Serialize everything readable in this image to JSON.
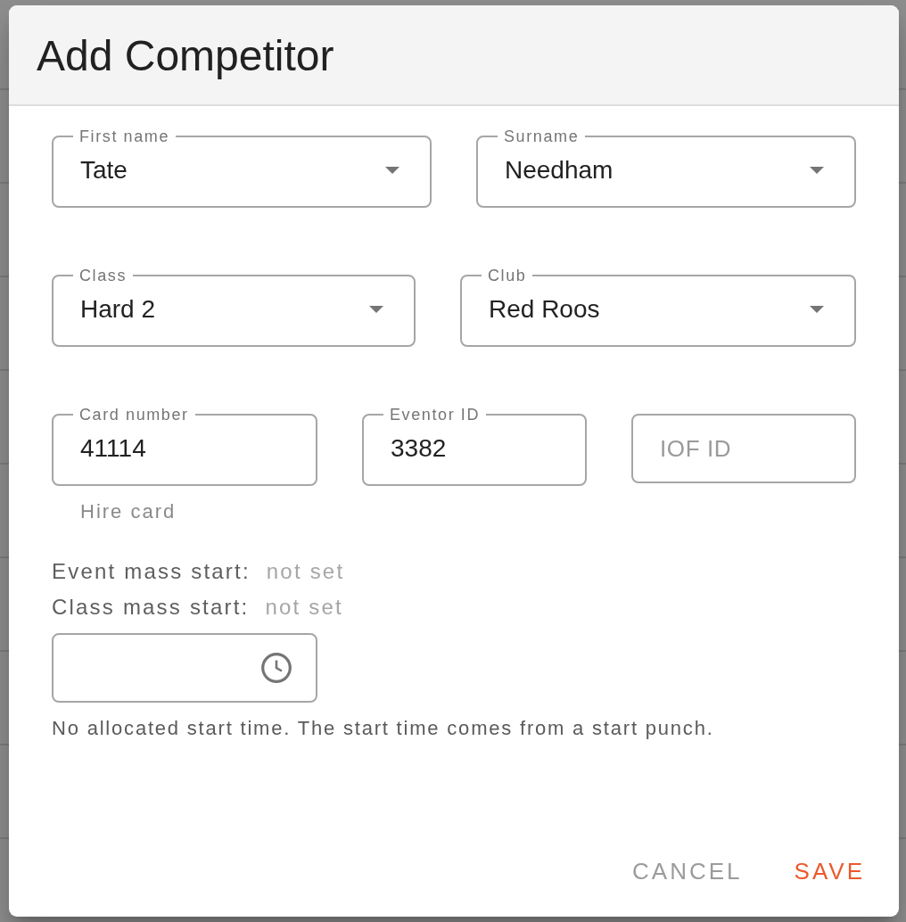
{
  "dialog": {
    "title": "Add Competitor"
  },
  "field_rows": [
    [
      {
        "kind": "select",
        "label": "First name",
        "value": "Tate"
      },
      {
        "kind": "select",
        "label": "Surname",
        "value": "Needham"
      }
    ],
    [
      {
        "kind": "select",
        "label": "Class",
        "value": "Hard 2"
      },
      {
        "kind": "select",
        "label": "Club",
        "value": "Red Roos"
      }
    ],
    [
      {
        "kind": "text",
        "label": "Card number",
        "value": "41114",
        "helper": "Hire card"
      },
      {
        "kind": "text",
        "label": "Eventor ID",
        "value": "3382"
      },
      {
        "kind": "text",
        "placeholder": "IOF ID"
      }
    ]
  ],
  "mass_starts": [
    {
      "label": "Event mass start:",
      "value": "not set"
    },
    {
      "label": "Class mass start:",
      "value": "not set"
    }
  ],
  "start_time": {
    "kind": "time",
    "helper": "No allocated start time. The start time comes from a start punch."
  },
  "buttons": [
    {
      "label": "CANCEL",
      "kind": "secondary"
    },
    {
      "label": "SAVE",
      "kind": "primary"
    }
  ]
}
